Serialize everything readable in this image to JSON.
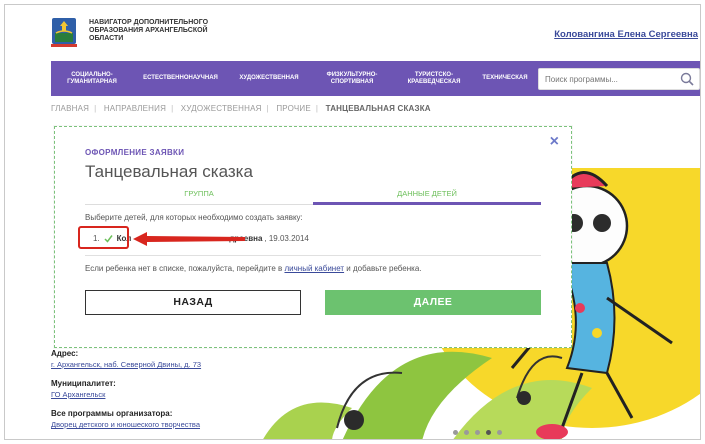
{
  "header": {
    "logo_lines": [
      "НАВИГАТОР ДОПОЛНИТЕЛЬНОГО",
      "ОБРАЗОВАНИЯ АРХАНГЕЛЬСКОЙ",
      "ОБЛАСТИ"
    ],
    "user_name": "Коловангина Елена Сергеевна"
  },
  "nav": {
    "items": [
      {
        "label": "СОЦИАЛЬНО-\nГУМАНИТАРНАЯ"
      },
      {
        "label": "ЕСТЕСТВЕННОНАУЧНАЯ"
      },
      {
        "label": "ХУДОЖЕСТВЕННАЯ"
      },
      {
        "label": "ФИЗКУЛЬТУРНО-\nСПОРТИВНАЯ"
      },
      {
        "label": "ТУРИСТСКО-\nКРАЕВЕДЧЕСКАЯ"
      },
      {
        "label": "ТЕХНИЧЕСКАЯ"
      }
    ],
    "search_placeholder": "Поиск программы..."
  },
  "breadcrumb": [
    "ГЛАВНАЯ",
    "НАПРАВЛЕНИЯ",
    "ХУДОЖЕСТВЕННАЯ",
    "ПРОЧИЕ",
    "ТАНЦЕВАЛЬНАЯ СКАЗКА"
  ],
  "info": {
    "address_label": "Адрес:",
    "address_value": "г. Архангельск, наб. Северной Двины, д. 73",
    "municipality_label": "Муниципалитет:",
    "municipality_value": "ГО Архангельск",
    "all_programs_label": "Все программы организатора:",
    "all_programs_value": "Дворец детского и юношеского творчества"
  },
  "modal": {
    "label": "ОФОРМЛЕНИЕ ЗАЯВКИ",
    "title": "Танцевальная сказка",
    "close": "×",
    "tabs": {
      "group": "ГРУППА",
      "kids": "ДАННЫЕ ДЕТЕЙ"
    },
    "instruction": "Выберите детей, для которых необходимо создать заявку:",
    "child": {
      "number": "1.",
      "name_start": "Кол",
      "name_end": "дреевна",
      "date": ", 19.03.2014"
    },
    "note_before": "Если ребенка нет в списке, пожалуйста, перейдите в ",
    "note_link": "личный кабинет",
    "note_after": " и добавьте ребенка.",
    "back_label": "НАЗАД",
    "next_label": "ДАЛЕЕ"
  },
  "colors": {
    "nav_bg": "#6d55b4",
    "accent_green": "#6cc26f",
    "link": "#3a4a9a",
    "highlight_red": "#d8261e"
  },
  "carousel": {
    "dots": 5,
    "active": 3
  }
}
